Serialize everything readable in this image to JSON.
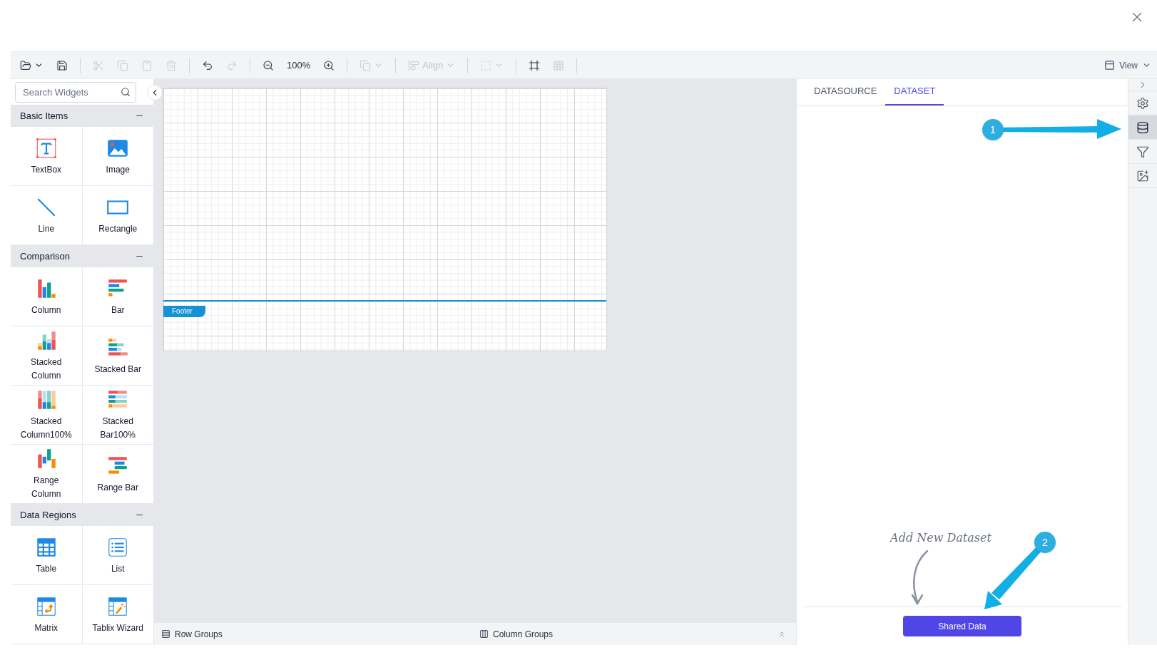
{
  "toolbar": {
    "items": [
      {
        "kind": "open",
        "dropdown": true,
        "disabled": false
      },
      {
        "kind": "save",
        "dropdown": false,
        "disabled": false
      },
      {
        "kind": "separator"
      },
      {
        "kind": "cut",
        "dropdown": false,
        "disabled": true
      },
      {
        "kind": "copy",
        "dropdown": false,
        "disabled": true
      },
      {
        "kind": "paste",
        "dropdown": false,
        "disabled": true
      },
      {
        "kind": "delete",
        "dropdown": false,
        "disabled": true
      },
      {
        "kind": "separator"
      },
      {
        "kind": "undo",
        "dropdown": false,
        "disabled": false
      },
      {
        "kind": "redo",
        "dropdown": false,
        "disabled": true
      },
      {
        "kind": "separator"
      },
      {
        "kind": "zoom-out",
        "dropdown": false,
        "disabled": false
      },
      {
        "kind": "zoom-level",
        "label": "100%",
        "dropdown": false,
        "disabled": false
      },
      {
        "kind": "zoom-in",
        "dropdown": false,
        "disabled": false
      },
      {
        "kind": "separator"
      },
      {
        "kind": "arrange",
        "dropdown": true,
        "disabled": true
      },
      {
        "kind": "separator"
      },
      {
        "kind": "align",
        "label": "Align",
        "dropdown": true,
        "disabled": true
      },
      {
        "kind": "separator"
      },
      {
        "kind": "group",
        "dropdown": true,
        "disabled": true
      },
      {
        "kind": "separator"
      },
      {
        "kind": "fit",
        "dropdown": false,
        "disabled": false
      },
      {
        "kind": "grid",
        "dropdown": false,
        "disabled": true
      },
      {
        "kind": "separator"
      }
    ],
    "view": "View"
  },
  "widgets": {
    "placeholder": "Search Widgets",
    "sections": [
      {
        "title": "Basic Items",
        "expanded": true,
        "items": [
          {
            "kind": "textbox",
            "label": "TextBox"
          },
          {
            "kind": "image",
            "label": "Image"
          },
          {
            "kind": "line",
            "label": "Line"
          },
          {
            "kind": "rectangle",
            "label": "Rectangle"
          }
        ]
      },
      {
        "title": "Comparison",
        "expanded": true,
        "items": [
          {
            "kind": "column",
            "label": "Column"
          },
          {
            "kind": "bar",
            "label": "Bar"
          },
          {
            "kind": "stacked-column",
            "label": "Stacked Column"
          },
          {
            "kind": "stacked-bar",
            "label": "Stacked Bar"
          },
          {
            "kind": "stacked-column-100",
            "label": "Stacked Column100%"
          },
          {
            "kind": "stacked-bar-100",
            "label": "Stacked Bar100%"
          },
          {
            "kind": "range-column",
            "label": "Range Column"
          },
          {
            "kind": "range-bar",
            "label": "Range Bar"
          }
        ]
      },
      {
        "title": "Data Regions",
        "expanded": true,
        "items": [
          {
            "kind": "table",
            "label": "Table"
          },
          {
            "kind": "list",
            "label": "List"
          },
          {
            "kind": "matrix",
            "label": "Matrix"
          },
          {
            "kind": "tablix",
            "label": "Tablix Wizard"
          }
        ]
      }
    ]
  },
  "canvas": {
    "footer_label": "Footer"
  },
  "bottom_bar": {
    "row_groups": "Row Groups",
    "column_groups": "Column Groups"
  },
  "properties_panel": {
    "tabs": [
      {
        "label": "DATASOURCE",
        "selected": false
      },
      {
        "label": "DATASET",
        "selected": true
      }
    ],
    "hint": "Add New Dataset",
    "button": "Shared Data"
  },
  "side_strip": [
    {
      "kind": "collapse",
      "selected": false
    },
    {
      "kind": "settings",
      "selected": false
    },
    {
      "kind": "data",
      "selected": true
    },
    {
      "kind": "filter",
      "selected": false
    },
    {
      "kind": "image-settings",
      "selected": false
    }
  ],
  "callouts": [
    {
      "label": "1"
    },
    {
      "label": "2"
    }
  ]
}
